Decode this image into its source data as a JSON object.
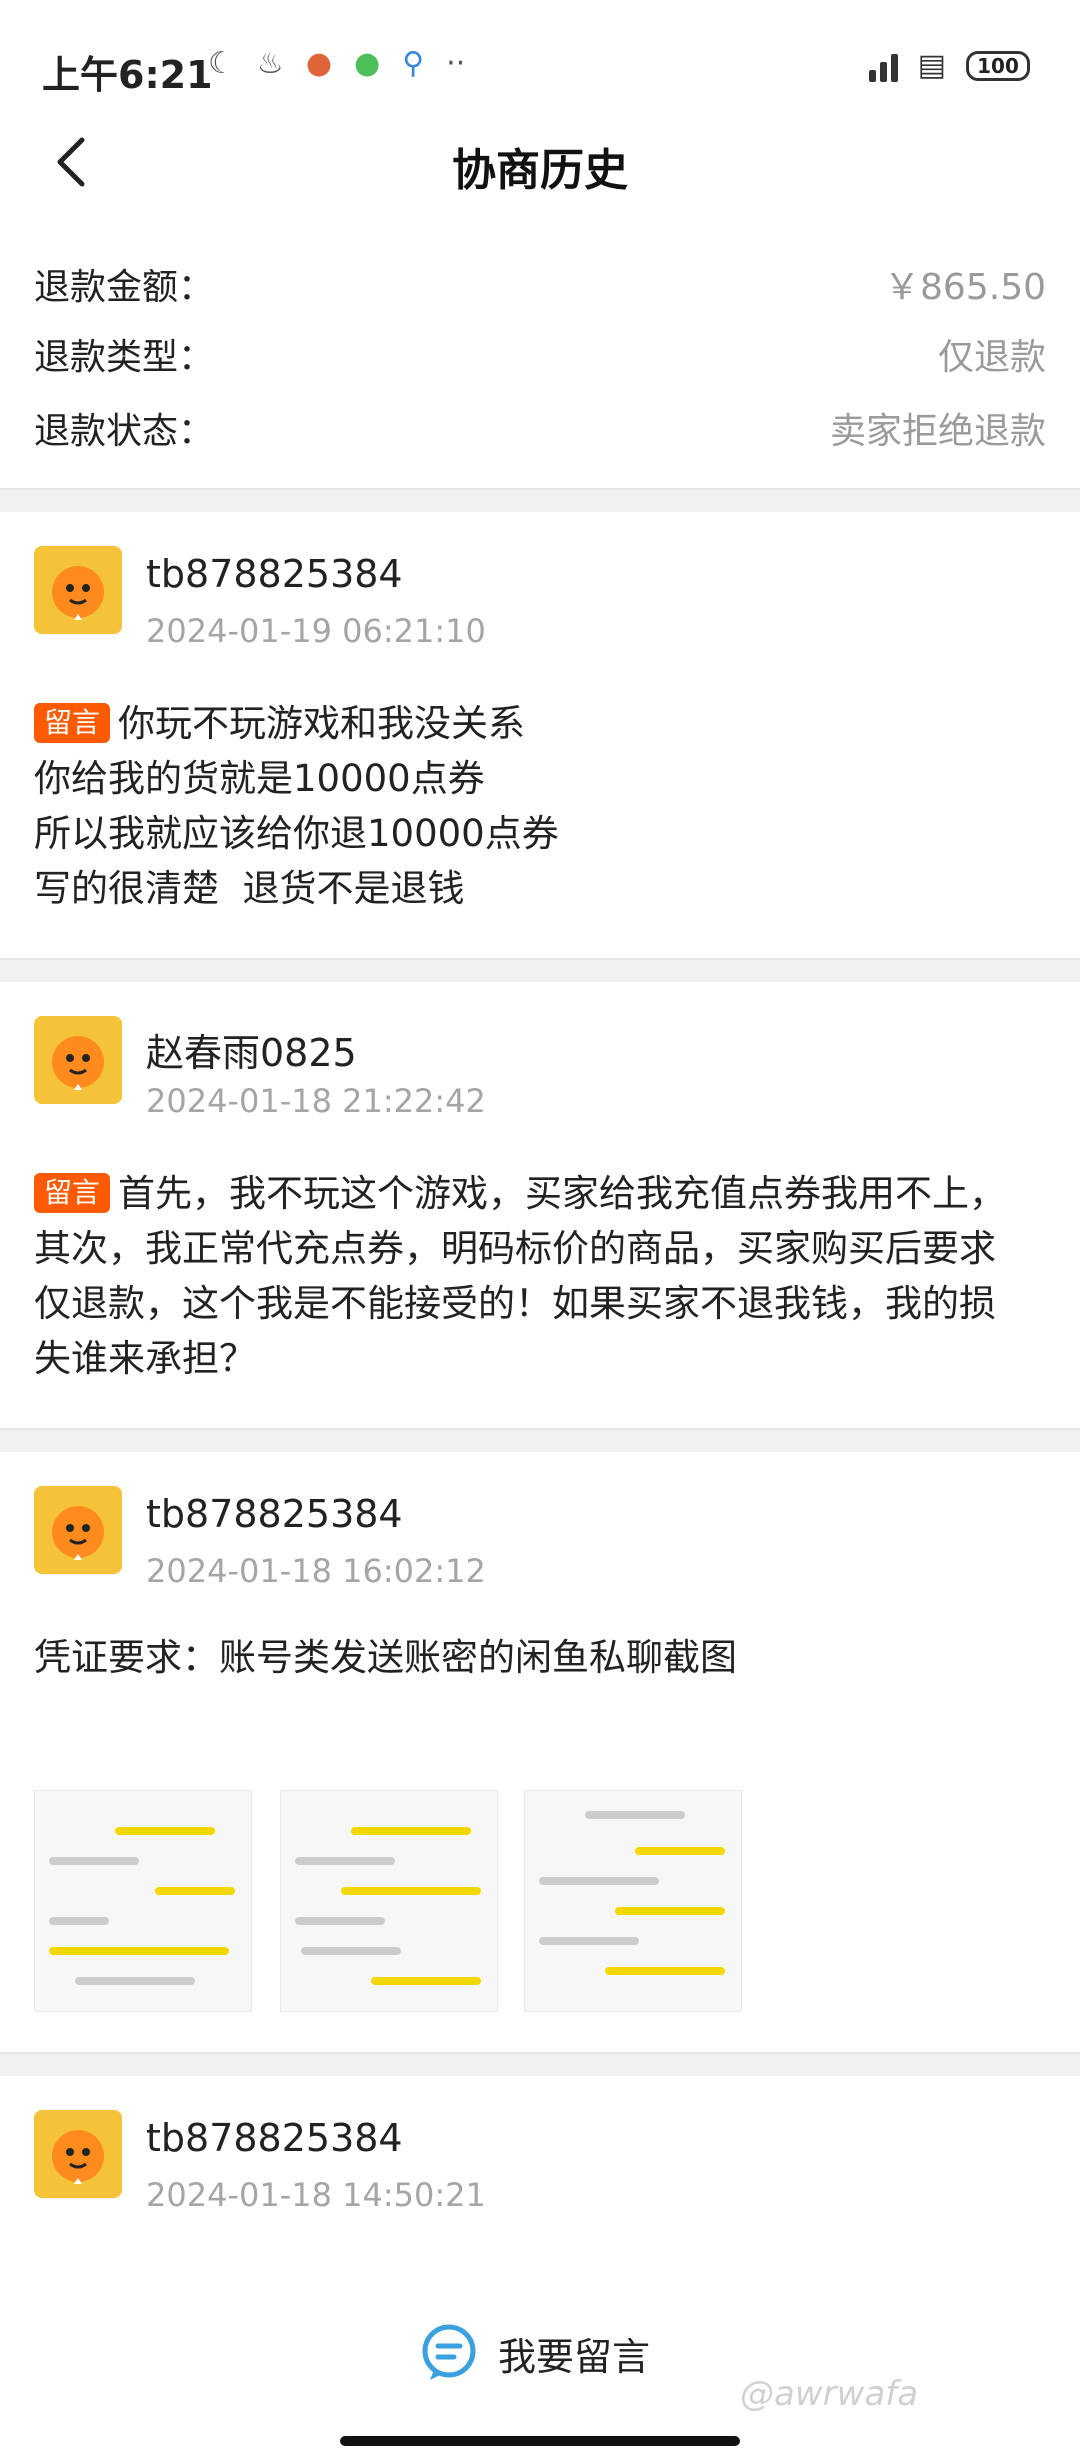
{
  "status_bar": {
    "time": "上午6:21",
    "battery": "100",
    "left_icons": [
      "moon-icon",
      "notification-icon",
      "app-icon",
      "chat-icon",
      "search-icon",
      "more-icon"
    ]
  },
  "header": {
    "title": "协商历史"
  },
  "summary": {
    "amount_label": "退款金额：",
    "amount_value": "￥865.50",
    "type_label": "退款类型：",
    "type_value": "仅退款",
    "status_label": "退款状态：",
    "status_value": "卖家拒绝退款"
  },
  "messages": [
    {
      "user": "tb878825384",
      "time": "2024-01-19 06:21:10",
      "tag": "留言",
      "lines": [
        "你玩不玩游戏和我没关系",
        "你给我的货就是10000点券",
        "所以我就应该给你退10000点券",
        "写的很清楚  退货不是退钱"
      ]
    },
    {
      "user": "赵春雨0825",
      "time": "2024-01-18 21:22:42",
      "tag": "留言",
      "lines": [
        "首先，我不玩这个游戏，买家给我充值点券我用不上，",
        "其次，我正常代充点券，明码标价的商品，买家购买后要求",
        "仅退款，这个我是不能接受的！如果买家不退我钱，我的损",
        "失谁来承担？"
      ]
    },
    {
      "user": "tb878825384",
      "time": "2024-01-18 16:02:12",
      "text": "凭证要求：账号类发送账密的闲鱼私聊截图"
    },
    {
      "user": "tb878825384",
      "time": "2024-01-18 14:50:21"
    }
  ],
  "bottom": {
    "leave_message": "我要留言",
    "watermark": "@awrwafa"
  },
  "colors": {
    "accent": "#ff5a00",
    "avatar": "#f5c33a",
    "button_icon": "#3aa0e0"
  }
}
